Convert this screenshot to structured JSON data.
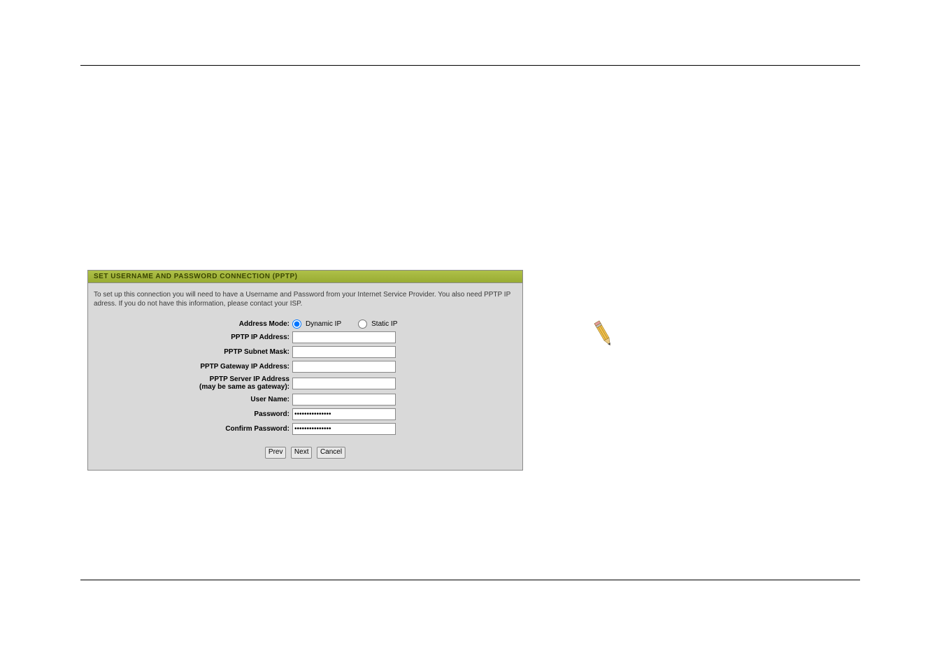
{
  "panel": {
    "title": "SET USERNAME AND PASSWORD CONNECTION (PPTP)",
    "description": "To set up this connection you will need to have a Username and Password from your Internet Service Provider. You also need PPTP IP adress. If you do not have this information, please contact your ISP."
  },
  "form": {
    "addressMode": {
      "label": "Address Mode:",
      "dynamic": "Dynamic IP",
      "static": "Static IP",
      "selected": "dynamic"
    },
    "pptpIp": {
      "label": "PPTP IP Address:",
      "value": ""
    },
    "pptpSubnet": {
      "label": "PPTP Subnet Mask:",
      "value": ""
    },
    "pptpGateway": {
      "label": "PPTP Gateway IP Address:",
      "value": ""
    },
    "pptpServer": {
      "labelLine1": "PPTP Server IP Address",
      "labelLine2": "(may be same as gateway):",
      "value": ""
    },
    "username": {
      "label": "User Name:",
      "value": ""
    },
    "password": {
      "label": "Password:",
      "value": "•••••••••••••••"
    },
    "confirmPassword": {
      "label": "Confirm Password:",
      "value": "•••••••••••••••"
    }
  },
  "buttons": {
    "prev": "Prev",
    "next": "Next",
    "cancel": "Cancel"
  }
}
